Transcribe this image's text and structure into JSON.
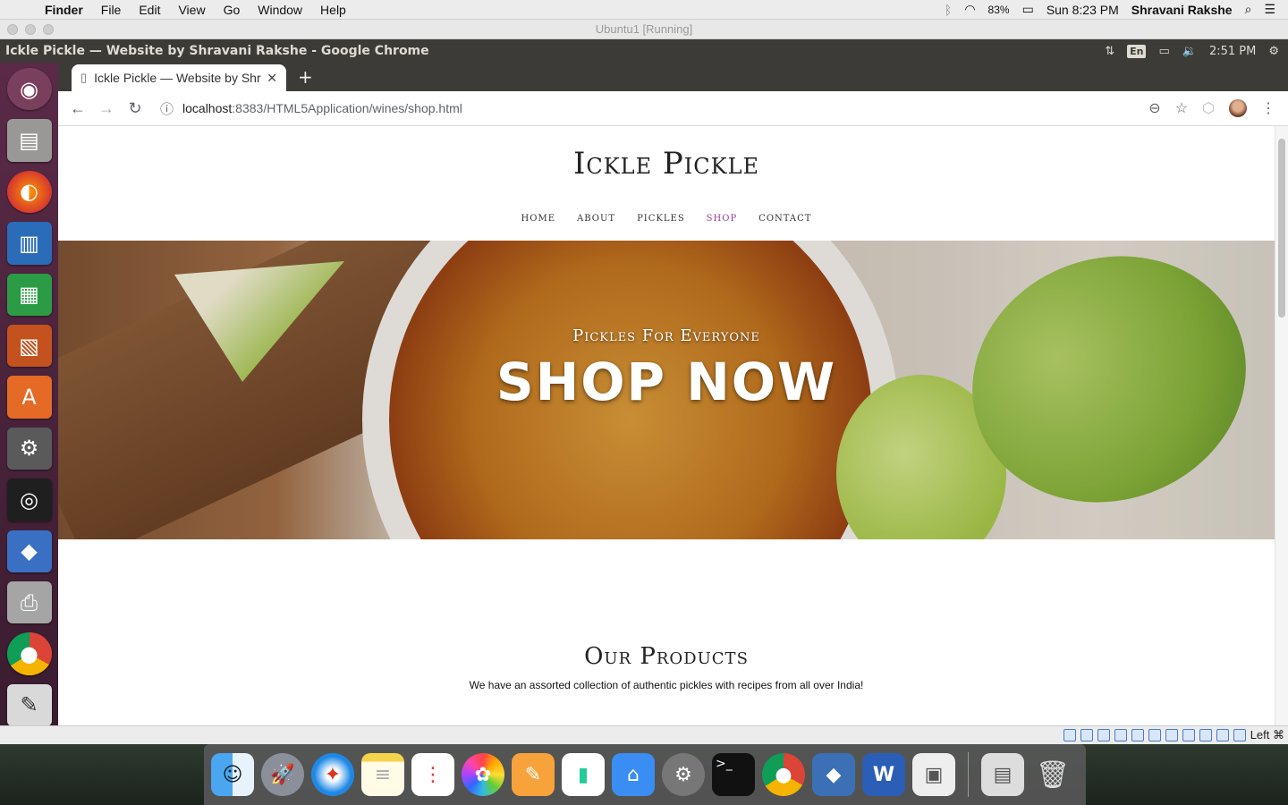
{
  "menubar": {
    "app": "Finder",
    "items": [
      "File",
      "Edit",
      "View",
      "Go",
      "Window",
      "Help"
    ],
    "battery": "83%",
    "clock": "Sun 8:23 PM",
    "user": "Shravani Rakshe"
  },
  "vbox": {
    "title": "Ubuntu1 [Running]",
    "host_key": "Left ⌘"
  },
  "ubuntu_bar": {
    "window_title": "Ickle Pickle — Website by Shravani Rakshe - Google Chrome",
    "keyboard": "En",
    "time": "2:51 PM"
  },
  "chrome": {
    "tab_title": "Ickle Pickle — Website by Shravani Rakshe",
    "url_host": "localhost",
    "url_path": ":8383/HTML5Application/wines/shop.html"
  },
  "site": {
    "title": "Ickle Pickle",
    "nav": [
      "HOME",
      "ABOUT",
      "PICKLES",
      "SHOP",
      "CONTACT"
    ],
    "nav_active": "SHOP",
    "hero_tagline": "Pickles For Everyone",
    "hero_cta": "SHOP NOW",
    "products_heading": "Our Products",
    "products_subtitle": "We have an assorted collection of authentic pickles with recipes from all over India!"
  }
}
